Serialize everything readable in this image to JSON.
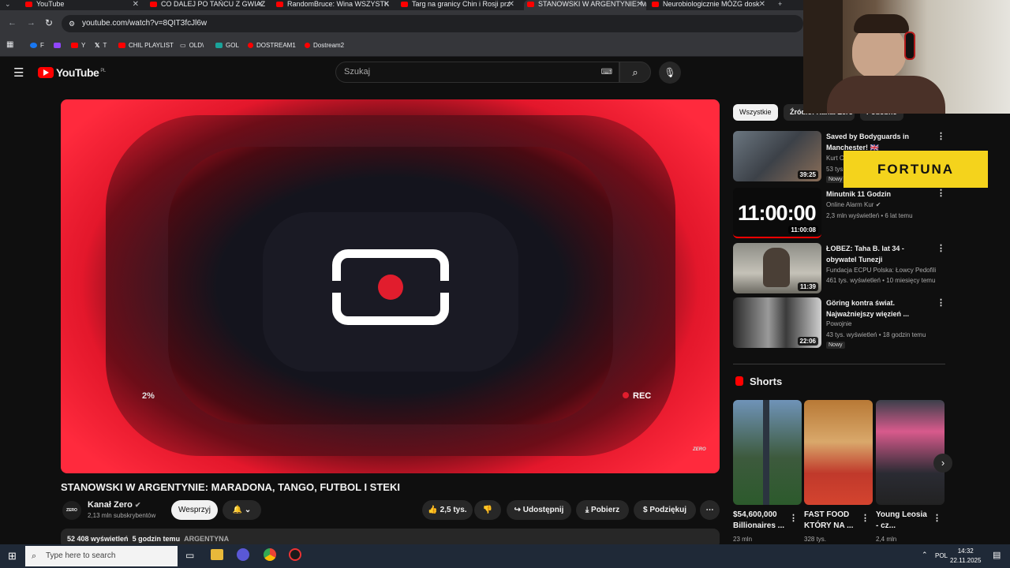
{
  "browser": {
    "tabs": [
      {
        "title": "YouTube"
      },
      {
        "title": "CO DALEJ PO TAŃCU Z GWIAZ"
      },
      {
        "title": "RandomBruce: Wina WSZYSTK"
      },
      {
        "title": "Targ na granicy Chin i Rosji prz"
      },
      {
        "title": "STANOWSKI W ARGENTYNIE: M"
      },
      {
        "title": "Neurobiologicznie MÓZG dosk"
      }
    ],
    "url": "youtube.com/watch?v=8QIT3fcJl6w",
    "bookmarks": [
      "F",
      "Y",
      "T",
      "CHIL PLAYLIST",
      "OLD\\",
      "GOL",
      "DOSTREAM1",
      "Dostream2"
    ]
  },
  "header": {
    "logo": "YouTube",
    "country": "PL",
    "search_placeholder": "Szukaj"
  },
  "player": {
    "progress_text": "2%",
    "rec_label": "REC",
    "watermark": "ZERO"
  },
  "video": {
    "title": "STANOWSKI W ARGENTYNIE: MARADONA, TANGO, FUTBOL I STEKI",
    "channel": "Kanał Zero",
    "channel_avatar_text": "ZERO",
    "subscribers": "2,13 mln subskrybentów",
    "join_label": "Wesprzyj",
    "likes": "2,5 tys.",
    "share_label": "Udostępnij",
    "download_label": "Pobierz",
    "thanks_label": "Podziękuj",
    "views": "52 408 wyświetleń",
    "age": "5 godzin temu",
    "hashtag": "ARGENTYNA"
  },
  "chips": [
    "Wszystkie",
    "Źródło: Kanał Zero",
    "Podobne"
  ],
  "recommendations": [
    {
      "title": "Saved by Bodyguards in Manchester! 🇬🇧",
      "channel": "Kurt C",
      "meta": "53 tys",
      "badge": "Nowy",
      "duration": "39:25"
    },
    {
      "title": "Minutnik 11 Godzin",
      "channel": "Online Alarm Kur",
      "meta": "2,3 mln wyświetleń • 6 lat temu",
      "duration": "11:00:08",
      "thumb_text": "11:00:00"
    },
    {
      "title": "ŁOBEZ: Taha B. lat 34 - obywatel Tunezji",
      "channel": "Fundacja ECPU Polska: Łowcy Pedofili",
      "meta": "461 tys. wyświetleń • 10 miesięcy temu",
      "duration": "11:39"
    },
    {
      "title": "Göring kontra świat. Najważniejszy więzień ...",
      "channel": "Powojnie",
      "meta": "43 tys. wyświetleń • 18 godzin temu",
      "badge": "Nowy",
      "duration": "22:06"
    }
  ],
  "shorts": {
    "label": "Shorts",
    "items": [
      {
        "title": "$54,600,000 Billionaires ...",
        "views": "23 mln"
      },
      {
        "title": "FAST FOOD KTÓRY NA ...",
        "views": "328 tys."
      },
      {
        "title": "Young Leosia - cz...",
        "views": "2,4 mln"
      }
    ]
  },
  "overlay": {
    "sponsor": "FORTUNA"
  },
  "taskbar": {
    "search_placeholder": "Type here to search",
    "lang": "POL",
    "time": "14:32",
    "date": "22.11.2025"
  }
}
